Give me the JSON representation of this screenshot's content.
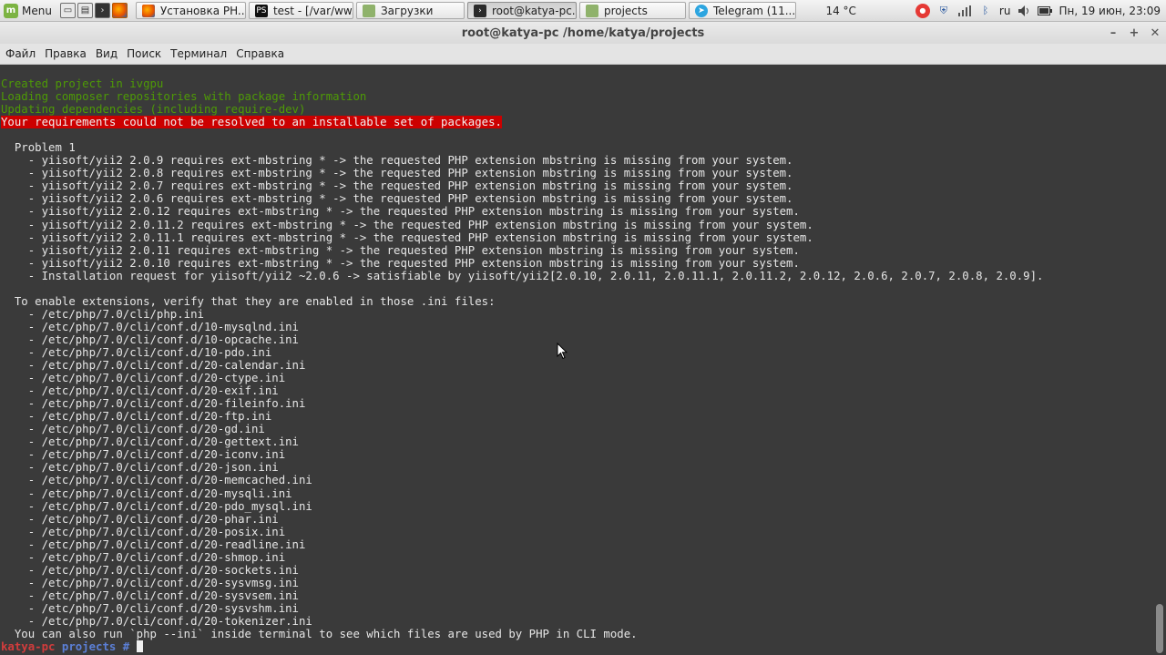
{
  "taskbar": {
    "menu_label": "Menu",
    "tasks": [
      {
        "label": "Установка PH...",
        "icon": "firefox-icon"
      },
      {
        "label": "test - [/var/ww...",
        "icon": "phpstorm-icon"
      },
      {
        "label": "Загрузки",
        "icon": "folder-icon"
      },
      {
        "label": "root@katya-pc...",
        "icon": "terminal-icon"
      },
      {
        "label": "projects",
        "icon": "folder-icon"
      },
      {
        "label": "Telegram (11...",
        "icon": "telegram-icon"
      }
    ],
    "temperature": "14 °C",
    "keyboard_layout": "ru",
    "clock": "Пн, 19 июн, 23:09"
  },
  "window": {
    "title": "root@katya-pc /home/katya/projects",
    "menu": [
      "Файл",
      "Правка",
      "Вид",
      "Поиск",
      "Терминал",
      "Справка"
    ]
  },
  "terminal": {
    "lines": [
      {
        "text": "Created project in ivgpu",
        "style": "g"
      },
      {
        "text": "Loading composer repositories with package information",
        "style": "g"
      },
      {
        "text": "Updating dependencies (including require-dev)",
        "style": "g"
      },
      {
        "text": "Your requirements could not be resolved to an installable set of packages.",
        "style": "err"
      },
      {
        "text": "",
        "style": ""
      },
      {
        "text": "  Problem 1",
        "style": ""
      },
      {
        "text": "    - yiisoft/yii2 2.0.9 requires ext-mbstring * -> the requested PHP extension mbstring is missing from your system.",
        "style": ""
      },
      {
        "text": "    - yiisoft/yii2 2.0.8 requires ext-mbstring * -> the requested PHP extension mbstring is missing from your system.",
        "style": ""
      },
      {
        "text": "    - yiisoft/yii2 2.0.7 requires ext-mbstring * -> the requested PHP extension mbstring is missing from your system.",
        "style": ""
      },
      {
        "text": "    - yiisoft/yii2 2.0.6 requires ext-mbstring * -> the requested PHP extension mbstring is missing from your system.",
        "style": ""
      },
      {
        "text": "    - yiisoft/yii2 2.0.12 requires ext-mbstring * -> the requested PHP extension mbstring is missing from your system.",
        "style": ""
      },
      {
        "text": "    - yiisoft/yii2 2.0.11.2 requires ext-mbstring * -> the requested PHP extension mbstring is missing from your system.",
        "style": ""
      },
      {
        "text": "    - yiisoft/yii2 2.0.11.1 requires ext-mbstring * -> the requested PHP extension mbstring is missing from your system.",
        "style": ""
      },
      {
        "text": "    - yiisoft/yii2 2.0.11 requires ext-mbstring * -> the requested PHP extension mbstring is missing from your system.",
        "style": ""
      },
      {
        "text": "    - yiisoft/yii2 2.0.10 requires ext-mbstring * -> the requested PHP extension mbstring is missing from your system.",
        "style": ""
      },
      {
        "text": "    - Installation request for yiisoft/yii2 ~2.0.6 -> satisfiable by yiisoft/yii2[2.0.10, 2.0.11, 2.0.11.1, 2.0.11.2, 2.0.12, 2.0.6, 2.0.7, 2.0.8, 2.0.9].",
        "style": ""
      },
      {
        "text": "",
        "style": ""
      },
      {
        "text": "  To enable extensions, verify that they are enabled in those .ini files:",
        "style": ""
      },
      {
        "text": "    - /etc/php/7.0/cli/php.ini",
        "style": ""
      },
      {
        "text": "    - /etc/php/7.0/cli/conf.d/10-mysqlnd.ini",
        "style": ""
      },
      {
        "text": "    - /etc/php/7.0/cli/conf.d/10-opcache.ini",
        "style": ""
      },
      {
        "text": "    - /etc/php/7.0/cli/conf.d/10-pdo.ini",
        "style": ""
      },
      {
        "text": "    - /etc/php/7.0/cli/conf.d/20-calendar.ini",
        "style": ""
      },
      {
        "text": "    - /etc/php/7.0/cli/conf.d/20-ctype.ini",
        "style": ""
      },
      {
        "text": "    - /etc/php/7.0/cli/conf.d/20-exif.ini",
        "style": ""
      },
      {
        "text": "    - /etc/php/7.0/cli/conf.d/20-fileinfo.ini",
        "style": ""
      },
      {
        "text": "    - /etc/php/7.0/cli/conf.d/20-ftp.ini",
        "style": ""
      },
      {
        "text": "    - /etc/php/7.0/cli/conf.d/20-gd.ini",
        "style": ""
      },
      {
        "text": "    - /etc/php/7.0/cli/conf.d/20-gettext.ini",
        "style": ""
      },
      {
        "text": "    - /etc/php/7.0/cli/conf.d/20-iconv.ini",
        "style": ""
      },
      {
        "text": "    - /etc/php/7.0/cli/conf.d/20-json.ini",
        "style": ""
      },
      {
        "text": "    - /etc/php/7.0/cli/conf.d/20-memcached.ini",
        "style": ""
      },
      {
        "text": "    - /etc/php/7.0/cli/conf.d/20-mysqli.ini",
        "style": ""
      },
      {
        "text": "    - /etc/php/7.0/cli/conf.d/20-pdo_mysql.ini",
        "style": ""
      },
      {
        "text": "    - /etc/php/7.0/cli/conf.d/20-phar.ini",
        "style": ""
      },
      {
        "text": "    - /etc/php/7.0/cli/conf.d/20-posix.ini",
        "style": ""
      },
      {
        "text": "    - /etc/php/7.0/cli/conf.d/20-readline.ini",
        "style": ""
      },
      {
        "text": "    - /etc/php/7.0/cli/conf.d/20-shmop.ini",
        "style": ""
      },
      {
        "text": "    - /etc/php/7.0/cli/conf.d/20-sockets.ini",
        "style": ""
      },
      {
        "text": "    - /etc/php/7.0/cli/conf.d/20-sysvmsg.ini",
        "style": ""
      },
      {
        "text": "    - /etc/php/7.0/cli/conf.d/20-sysvsem.ini",
        "style": ""
      },
      {
        "text": "    - /etc/php/7.0/cli/conf.d/20-sysvshm.ini",
        "style": ""
      },
      {
        "text": "    - /etc/php/7.0/cli/conf.d/20-tokenizer.ini",
        "style": ""
      },
      {
        "text": "  You can also run `php --ini` inside terminal to see which files are used by PHP in CLI mode.",
        "style": ""
      }
    ],
    "prompt": {
      "host": "katya-pc",
      "dir": "projects",
      "symbol": "#"
    }
  },
  "colors": {
    "terminal_bg": "#3a3a3a",
    "success_green": "#4e9a06",
    "error_red": "#cc0000",
    "prompt_host": "#d23c3c",
    "prompt_dir": "#5b7fd6"
  }
}
